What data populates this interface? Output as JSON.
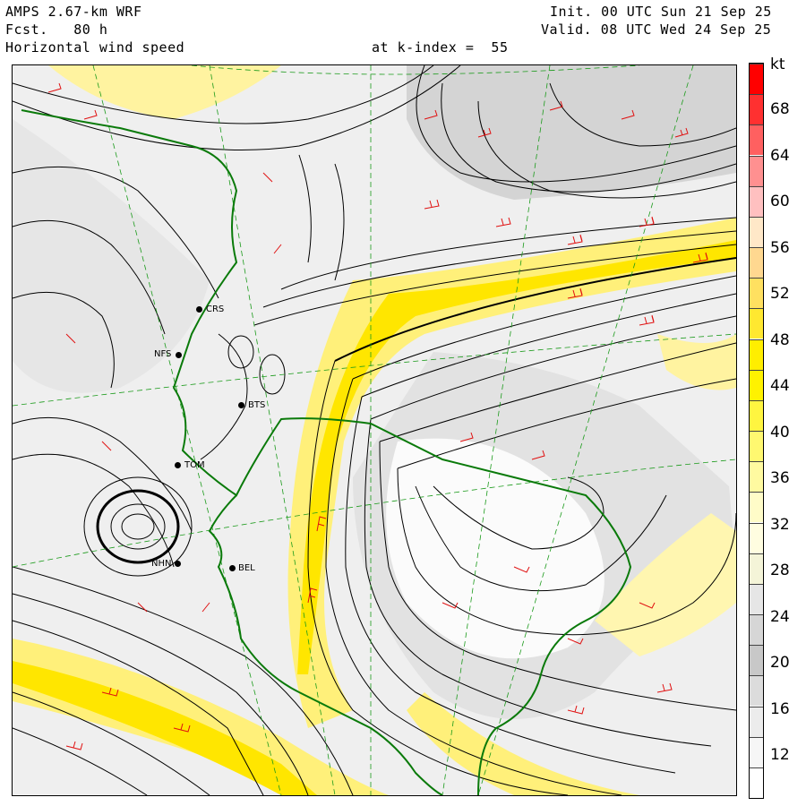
{
  "header": {
    "model": "AMPS 2.67-km WRF",
    "forecast": "Fcst.   80 h",
    "field": "Horizontal wind speed",
    "level": "at k-index =  55",
    "init": "Init. 00 UTC Sun 21 Sep 25",
    "valid": "Valid. 08 UTC Wed 24 Sep 25"
  },
  "colorbar": {
    "unit": "kt",
    "tick_labels": [
      "68",
      "64",
      "60",
      "56",
      "52",
      "48",
      "44",
      "40",
      "36",
      "32",
      "28",
      "24",
      "20",
      "16",
      "12"
    ],
    "segments": [
      "#ff0000",
      "#ff3030",
      "#ff6060",
      "#ff9090",
      "#ffc0c0",
      "#ffe8c8",
      "#ffd890",
      "#ffe060",
      "#ffe830",
      "#ffee00",
      "#fff200",
      "#fff540",
      "#fff870",
      "#fffaa0",
      "#fffcc8",
      "#fffde0",
      "#f4f4d8",
      "#e6e6e6",
      "#d6d6d6",
      "#c8c8c8",
      "#dcdcdc",
      "#ececec",
      "#f6f6f6",
      "#ffffff"
    ]
  },
  "stations": [
    {
      "code": "CRS"
    },
    {
      "code": "NFS"
    },
    {
      "code": "BTS"
    },
    {
      "code": "TOM"
    },
    {
      "code": "NHN"
    },
    {
      "code": "BEL"
    }
  ]
}
